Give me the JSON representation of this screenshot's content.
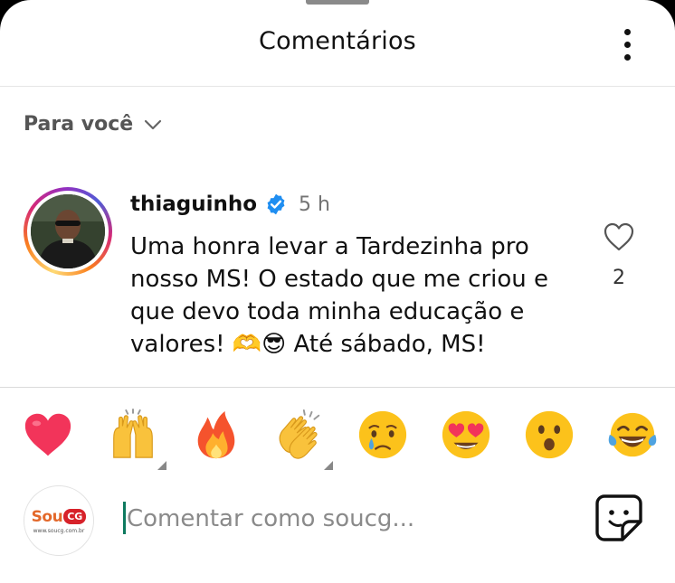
{
  "header": {
    "title": "Comentários",
    "more_icon": "more-vertical-icon"
  },
  "filter": {
    "label": "Para você",
    "icon": "chevron-down-icon"
  },
  "comment": {
    "username": "thiaguinho",
    "verified": true,
    "time": "5 h",
    "text": "Uma honra levar a Tardezinha pro nosso MS! O estado que me criou e que devo toda minha educação e valores! 🫶😎 Até sábado, MS!",
    "like_count": "2",
    "like_icon": "heart-outline-icon"
  },
  "reactions": [
    {
      "emoji": "❤️",
      "name": "red-heart"
    },
    {
      "emoji": "🙌",
      "name": "raising-hands"
    },
    {
      "emoji": "🔥",
      "name": "fire"
    },
    {
      "emoji": "👏",
      "name": "clapping-hands"
    },
    {
      "emoji": "😢",
      "name": "crying-face"
    },
    {
      "emoji": "😍",
      "name": "heart-eyes"
    },
    {
      "emoji": "😮",
      "name": "surprised-face"
    },
    {
      "emoji": "😂",
      "name": "tears-of-joy"
    }
  ],
  "compose": {
    "placeholder": "Comentar como soucg...",
    "avatar_logo_text": "Sou",
    "avatar_logo_badge": "CG",
    "avatar_logo_url": "www.soucg.com.br",
    "sticker_icon": "sticker-icon"
  },
  "colors": {
    "verified_blue": "#1f8ef1",
    "brand_orange": "#e3682a",
    "brand_red": "#d7222a"
  }
}
